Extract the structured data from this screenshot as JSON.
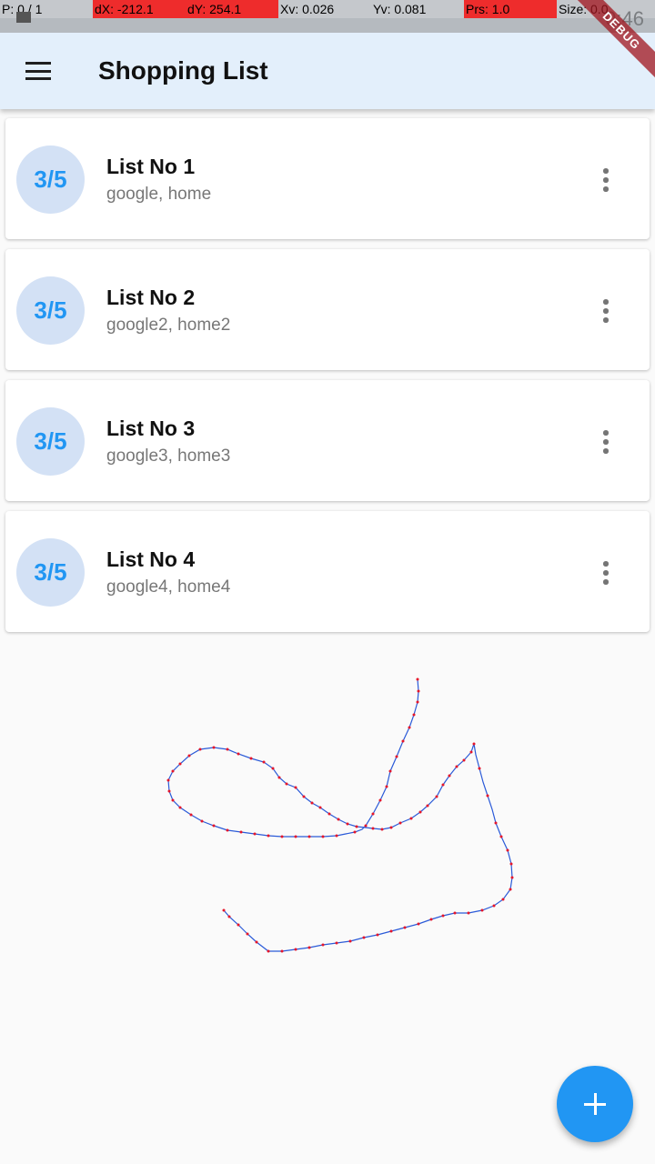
{
  "pointer_location": {
    "pointer": "P: 0 / 1",
    "dx": "dX: -212.1",
    "dy": "dY: 254.1",
    "xv": "Xv: 0.026",
    "yv": "Yv: 0.081",
    "pressure": "Prs: 1.0",
    "size": "Size: 0.0"
  },
  "status_bar": {
    "time": "0:46"
  },
  "debug_banner": "DEBUG",
  "app_bar": {
    "title": "Shopping List",
    "menu_icon": "menu-icon"
  },
  "lists": [
    {
      "badge": "3/5",
      "title": "List No 1",
      "subtitle": "google, home"
    },
    {
      "badge": "3/5",
      "title": "List No 2",
      "subtitle": "google2, home2"
    },
    {
      "badge": "3/5",
      "title": "List No 3",
      "subtitle": "google3, home3"
    },
    {
      "badge": "3/5",
      "title": "List No 4",
      "subtitle": "google4, home4"
    }
  ],
  "fab": {
    "icon": "plus-icon"
  },
  "colors": {
    "primary": "#2196f3",
    "app_bar": "#e3effb",
    "avatar_bg": "#d3e1f5",
    "trace_line": "#2a5ad8",
    "trace_points": "#e5162b",
    "debug_red": "#ee2c2c"
  }
}
